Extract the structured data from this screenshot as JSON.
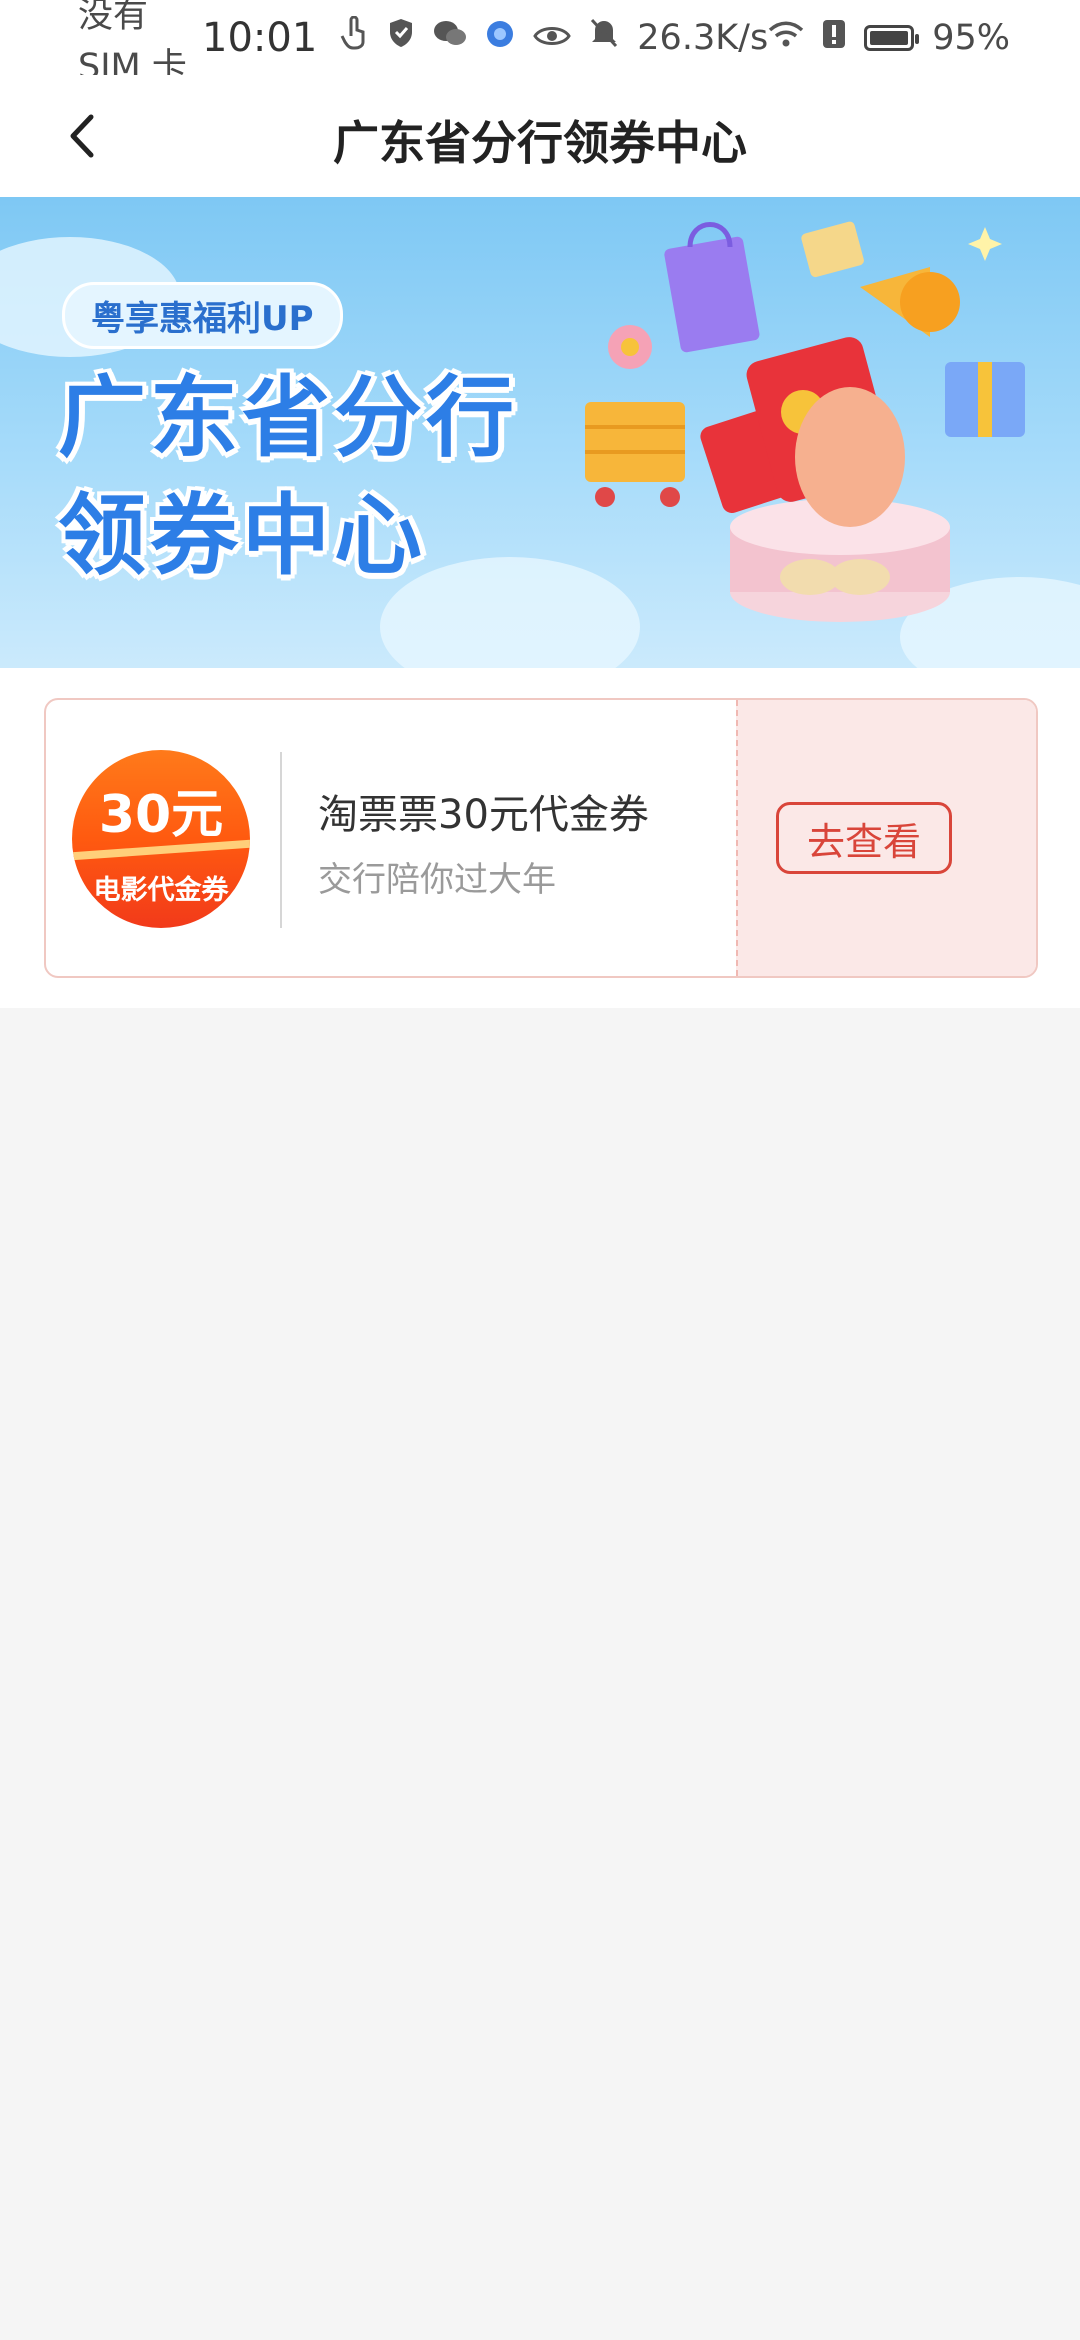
{
  "status_bar": {
    "carrier": "没有 SIM 卡",
    "time": "10:01",
    "net_speed": "26.3K/s",
    "battery": "95%"
  },
  "nav": {
    "title": "广东省分行领券中心",
    "back_icon": "chevron-left-icon"
  },
  "banner": {
    "badge": "粤享惠福利UP",
    "title_line1": "广东省分行",
    "title_line2": "领券中心"
  },
  "coupon": {
    "amount": "30元",
    "logo_label": "电影代金券",
    "title": "淘票票30元代金券",
    "subtitle": "交行陪你过大年",
    "button_label": "去查看"
  },
  "colors": {
    "accent": "#d9453a",
    "banner_blue": "#2d7ee6",
    "coupon_orange": "#ff5a10"
  }
}
